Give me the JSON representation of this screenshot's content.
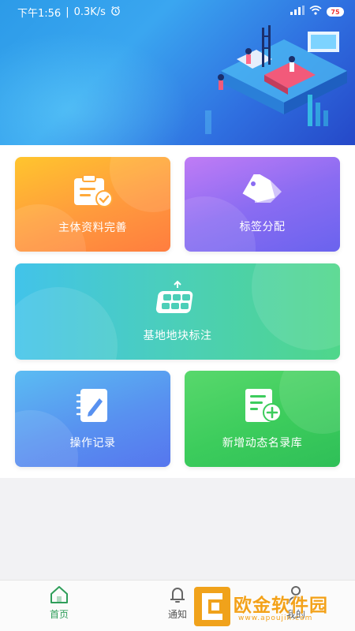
{
  "status_bar": {
    "time": "下午1:56",
    "speed": "0.3K/s",
    "battery": "75"
  },
  "cards": [
    {
      "label": "主体资料完善",
      "icon": "clipboard-check-icon"
    },
    {
      "label": "标签分配",
      "icon": "tag-icon"
    },
    {
      "label": "基地地块标注",
      "icon": "field-plot-icon"
    },
    {
      "label": "操作记录",
      "icon": "notebook-edit-icon"
    },
    {
      "label": "新增动态名录库",
      "icon": "document-add-icon"
    }
  ],
  "bottom_nav": {
    "items": [
      {
        "label": "首页",
        "icon": "home-icon",
        "active": true
      },
      {
        "label": "通知",
        "icon": "bell-icon",
        "active": false
      },
      {
        "label": "我的",
        "icon": "user-icon",
        "active": false
      }
    ]
  },
  "watermark": {
    "text": "欧金软件园",
    "url": "www.apoujin.com"
  },
  "colors": {
    "active_nav": "#2f9e5a",
    "header": "#2f8fe6"
  }
}
